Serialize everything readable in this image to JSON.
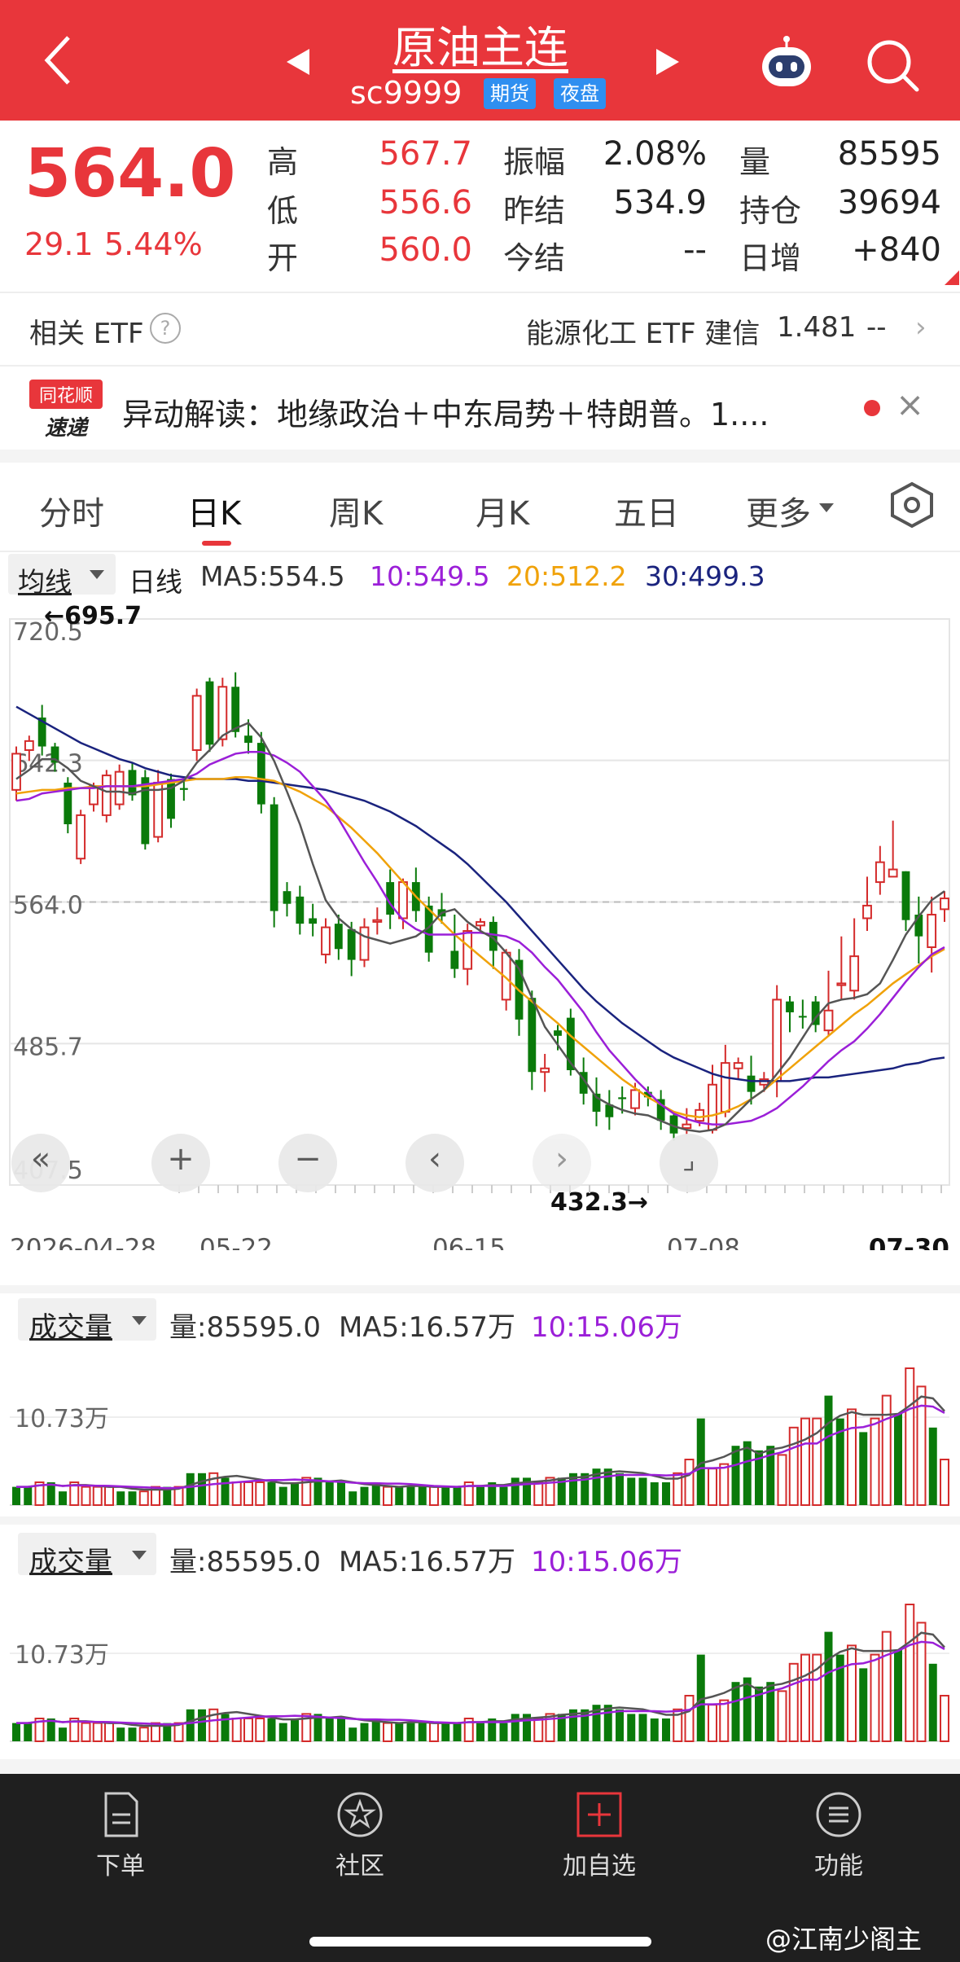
{
  "header": {
    "title": "原油主连",
    "code": "sc9999",
    "tag_futures": "期货",
    "tag_night": "夜盘",
    "bg_color": "#e8363b"
  },
  "quote": {
    "price": "564.0",
    "change": "29.1",
    "change_pct": "5.44%",
    "rows": [
      {
        "l1": "高",
        "v1": "567.7",
        "l2": "振幅",
        "v2": "2.08%",
        "l3": "量",
        "v3": "85595"
      },
      {
        "l1": "低",
        "v1": "556.6",
        "l2": "昨结",
        "v2": "534.9",
        "l3": "持仓",
        "v3": "39694"
      },
      {
        "l1": "开",
        "v1": "560.0",
        "l2": "今结",
        "v2": "--",
        "l3": "日增",
        "v3": "+840"
      }
    ]
  },
  "etf": {
    "label": "相关 ETF",
    "help": "?",
    "name": "能源化工 ETF 建信",
    "value": "1.481",
    "change": "--"
  },
  "news": {
    "logo_top": "同花顺",
    "logo_bottom": "速递",
    "text": "异动解读：地缘政治＋中东局势＋特朗普。1....",
    "close": "×"
  },
  "tabs": [
    "分时",
    "日K",
    "周K",
    "月K",
    "五日",
    "更多"
  ],
  "active_tab": "日K",
  "ma_bar": {
    "button": "均线",
    "period": "日线",
    "ma5": "MA5:554.5",
    "ma10": "10:549.5",
    "ma20": "20:512.2",
    "ma30": "30:499.3"
  },
  "chart_data": {
    "type": "candlestick",
    "y_ticks": [
      "720.5",
      "642.3",
      "564.0",
      "485.7",
      "407.5"
    ],
    "ylim": [
      407.5,
      720.5
    ],
    "x_ticks": [
      "2026-04-28",
      "05-22",
      "06-15",
      "07-08",
      "07-30"
    ],
    "high_label": "←695.7",
    "low_label": "432.3→",
    "current": 564.0,
    "candles": [
      [
        626,
        646,
        620,
        650,
        "u"
      ],
      [
        648,
        653,
        642,
        656,
        "u"
      ],
      [
        666,
        650,
        645,
        673,
        "d"
      ],
      [
        650,
        641,
        636,
        652,
        "d"
      ],
      [
        630,
        607,
        602,
        633,
        "d"
      ],
      [
        588,
        612,
        585,
        615,
        "u"
      ],
      [
        618,
        628,
        614,
        630,
        "u"
      ],
      [
        612,
        634,
        608,
        637,
        "u"
      ],
      [
        618,
        636,
        615,
        640,
        "u"
      ],
      [
        637,
        623,
        620,
        641,
        "d"
      ],
      [
        633,
        596,
        593,
        637,
        "d"
      ],
      [
        600,
        630,
        597,
        637,
        "u"
      ],
      [
        632,
        610,
        605,
        635,
        "d"
      ],
      [
        626,
        627,
        620,
        633,
        "d"
      ],
      [
        648,
        678,
        642,
        682,
        "u"
      ],
      [
        686,
        651,
        647,
        688,
        "d"
      ],
      [
        654,
        683,
        650,
        688,
        "u"
      ],
      [
        683,
        658,
        655,
        691,
        "d"
      ],
      [
        656,
        652,
        646,
        665,
        "d"
      ],
      [
        652,
        618,
        613,
        658,
        "d"
      ],
      [
        618,
        559,
        550,
        622,
        "d"
      ],
      [
        570,
        563,
        556,
        575,
        "d"
      ],
      [
        567,
        552,
        546,
        573,
        "d"
      ],
      [
        555,
        552,
        545,
        563,
        "d"
      ],
      [
        535,
        550,
        530,
        555,
        "u"
      ],
      [
        552,
        538,
        532,
        557,
        "d"
      ],
      [
        549,
        532,
        523,
        553,
        "d"
      ],
      [
        532,
        550,
        528,
        555,
        "u"
      ],
      [
        553,
        554,
        546,
        561,
        "u"
      ],
      [
        575,
        557,
        549,
        582,
        "d"
      ],
      [
        555,
        575,
        549,
        577,
        "u"
      ],
      [
        575,
        559,
        553,
        583,
        "d"
      ],
      [
        562,
        536,
        531,
        567,
        "d"
      ],
      [
        560,
        556,
        552,
        569,
        "d"
      ],
      [
        537,
        527,
        522,
        557,
        "d"
      ],
      [
        527,
        548,
        518,
        552,
        "u"
      ],
      [
        551,
        553,
        547,
        555,
        "u"
      ],
      [
        553,
        537,
        527,
        556,
        "d"
      ],
      [
        510,
        536,
        504,
        538,
        "u"
      ],
      [
        532,
        499,
        490,
        538,
        "d"
      ],
      [
        511,
        470,
        460,
        515,
        "d"
      ],
      [
        470,
        472,
        459,
        480,
        "u"
      ],
      [
        493,
        490,
        482,
        496,
        "d"
      ],
      [
        500,
        471,
        468,
        505,
        "d"
      ],
      [
        470,
        458,
        452,
        478,
        "d"
      ],
      [
        458,
        448,
        440,
        467,
        "d"
      ],
      [
        452,
        445,
        438,
        460,
        "d"
      ],
      [
        456,
        455,
        447,
        462,
        "d"
      ],
      [
        450,
        460,
        446,
        464,
        "u"
      ],
      [
        459,
        456,
        451,
        462,
        "d"
      ],
      [
        455,
        443,
        438,
        460,
        "d"
      ],
      [
        446,
        436,
        432,
        448,
        "d"
      ],
      [
        439,
        441,
        435,
        450,
        "u"
      ],
      [
        443,
        449,
        440,
        453,
        "u"
      ],
      [
        463,
        438,
        436,
        474,
        "u"
      ],
      [
        448,
        475,
        445,
        485,
        "u"
      ],
      [
        475,
        472,
        466,
        478,
        "u"
      ],
      [
        468,
        459,
        452,
        479,
        "d"
      ],
      [
        463,
        466,
        459,
        470,
        "u"
      ],
      [
        465,
        510,
        456,
        518,
        "u"
      ],
      [
        509,
        503,
        492,
        512,
        "d"
      ],
      [
        501,
        501,
        494,
        510,
        "d"
      ],
      [
        509,
        496,
        492,
        512,
        "d"
      ],
      [
        493,
        504,
        490,
        526,
        "u"
      ],
      [
        518,
        519,
        510,
        545,
        "u"
      ],
      [
        515,
        534,
        510,
        555,
        "u"
      ],
      [
        555,
        562,
        548,
        578,
        "u"
      ],
      [
        575,
        586,
        568,
        595,
        "u"
      ],
      [
        578,
        582,
        578,
        609,
        "u"
      ],
      [
        581,
        554,
        548,
        581,
        "d"
      ],
      [
        557,
        545,
        530,
        567,
        "d"
      ],
      [
        539,
        557,
        525,
        567,
        "u"
      ],
      [
        560,
        566,
        553,
        570,
        "u"
      ]
    ],
    "ma5": [
      632,
      637,
      643,
      643,
      638,
      631,
      628,
      625,
      625,
      624,
      626,
      626,
      627,
      631,
      641,
      648,
      656,
      660,
      663,
      655,
      642,
      625,
      607,
      585,
      565,
      555,
      549,
      545,
      543,
      541,
      543,
      545,
      550,
      558,
      560,
      553,
      548,
      544,
      536,
      527,
      511,
      495,
      485,
      475,
      466,
      456,
      452,
      449,
      447,
      446,
      443,
      440,
      438,
      437,
      438,
      441,
      448,
      455,
      460,
      469,
      478,
      489,
      500,
      508,
      510,
      511,
      513,
      519,
      532,
      546,
      556,
      565,
      570
    ],
    "ma10": [
      620,
      621,
      624,
      625,
      626,
      627,
      627,
      628,
      628,
      628,
      629,
      630,
      631,
      632,
      635,
      640,
      643,
      646,
      647,
      647,
      645,
      641,
      636,
      628,
      620,
      610,
      598,
      586,
      575,
      563,
      554,
      549,
      546,
      546,
      546,
      547,
      547,
      546,
      545,
      542,
      536,
      528,
      521,
      512,
      503,
      492,
      482,
      474,
      466,
      459,
      452,
      447,
      444,
      442,
      441,
      441,
      442,
      443,
      446,
      450,
      456,
      462,
      469,
      476,
      482,
      487,
      494,
      502,
      511,
      520,
      528,
      535,
      539
    ],
    "ma20": [
      624,
      625,
      626,
      626,
      627,
      627,
      628,
      628,
      628,
      628,
      628,
      629,
      630,
      631,
      632,
      632,
      632,
      633,
      633,
      632,
      631,
      628,
      625,
      621,
      617,
      611,
      605,
      598,
      591,
      583,
      575,
      567,
      560,
      553,
      546,
      540,
      534,
      528,
      522,
      515,
      509,
      503,
      497,
      490,
      484,
      478,
      472,
      466,
      461,
      456,
      452,
      448,
      446,
      445,
      446,
      448,
      451,
      455,
      460,
      466,
      472,
      478,
      484,
      490,
      496,
      502,
      507,
      513,
      519,
      524,
      529,
      534,
      538
    ],
    "ma30": [
      672,
      668,
      664,
      660,
      656,
      652,
      649,
      646,
      643,
      641,
      638,
      636,
      634,
      633,
      632,
      632,
      632,
      632,
      631,
      631,
      630,
      629,
      628,
      627,
      626,
      624,
      622,
      620,
      617,
      614,
      610,
      606,
      601,
      596,
      591,
      585,
      578,
      571,
      564,
      556,
      548,
      540,
      532,
      524,
      516,
      509,
      503,
      497,
      492,
      487,
      482,
      478,
      475,
      472,
      469,
      467,
      466,
      465,
      465,
      465,
      465,
      466,
      467,
      467,
      468,
      469,
      470,
      471,
      472,
      474,
      475,
      477,
      478
    ]
  },
  "volume": {
    "button": "成交量",
    "vol": "量:85595.0",
    "ma5": "MA5:16.57万",
    "ma10": "10:15.06万",
    "axis": "10.73万",
    "bars": [
      4,
      4,
      5,
      5,
      3,
      5,
      4,
      4,
      4,
      3,
      3,
      3,
      4,
      4,
      4,
      7,
      7,
      7,
      6,
      5,
      5,
      5,
      5,
      4,
      5,
      6,
      6,
      5,
      5,
      3,
      4,
      5,
      4,
      4,
      4,
      4,
      4,
      4,
      4,
      5,
      4,
      5,
      4,
      6,
      6,
      5,
      6,
      6,
      7,
      7,
      8,
      8,
      7,
      6,
      6,
      5,
      5,
      7,
      10,
      19,
      8,
      9,
      13,
      14,
      12,
      13,
      11,
      17,
      19,
      19,
      24,
      19,
      21,
      16,
      19,
      24,
      20,
      30,
      26,
      17,
      10
    ],
    "bar_dirs": "ddudduuuudduududduduuuddduddddddudddudduddddduudddddddddduuduudddduuuudduduuduuduuu"
  },
  "nav": {
    "order": "下单",
    "community": "社区",
    "add_watch": "加自选",
    "functions": "功能"
  },
  "watermark": "@江南少阁主"
}
